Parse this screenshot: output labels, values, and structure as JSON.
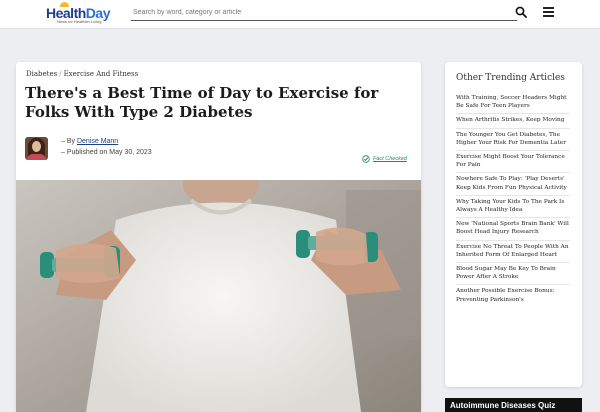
{
  "header": {
    "logo": {
      "brand_a": "Health",
      "brand_b": "Day",
      "tagline": "News for Healthier Living"
    },
    "search": {
      "placeholder": "Search by word, category or article"
    },
    "icons": {
      "search": "search-icon",
      "menu": "hamburger-menu-icon"
    }
  },
  "article": {
    "breadcrumb": {
      "category": "Diabetes",
      "separator": "/",
      "subcategory": "Exercise And Fitness"
    },
    "title": "There's a Best Time of Day to Exercise for Folks With Type 2 Diabetes",
    "byline": {
      "prefix": "– By ",
      "author": "Denise Mann"
    },
    "published": "– Published on May 30, 2023",
    "fact_checked": "Fact Checked",
    "hero_image": "man in white t-shirt holding two green dumbbells"
  },
  "sidebar": {
    "heading": "Other Trending Articles",
    "items": [
      "With Training, Soccer Headers Might Be Safe For Teen Players",
      "When Arthritis Strikes, Keep Moving",
      "The Younger You Get Diabetes, The Higher Your Risk For Dementia Later",
      "Exercise Might Boost Your Tolerance For Pain",
      "Nowhere Safe To Play: 'Play Deserts' Keep Kids From Fun Physical Activity",
      "Why Taking Your Kids To The Park Is Always A Healthy Idea",
      "New 'National Sports Brain Bank' Will Boost Head Injury Research",
      "Exercise No Threat To People With An Inherited Form Of Enlarged Heart",
      "Blood Sugar May Be Key To Brain Power After A Stroke",
      "Another Possible Exercise Bonus: Preventing Parkinson's"
    ]
  },
  "quiz_banner": "Autoimmune Diseases Quiz",
  "colors": {
    "brand_dark": "#1d3f8a",
    "brand_light": "#2a6fd1",
    "sun": "#f5b92e",
    "fact_check": "#1f8a5a",
    "dumbbell": "#2a8f7a"
  }
}
